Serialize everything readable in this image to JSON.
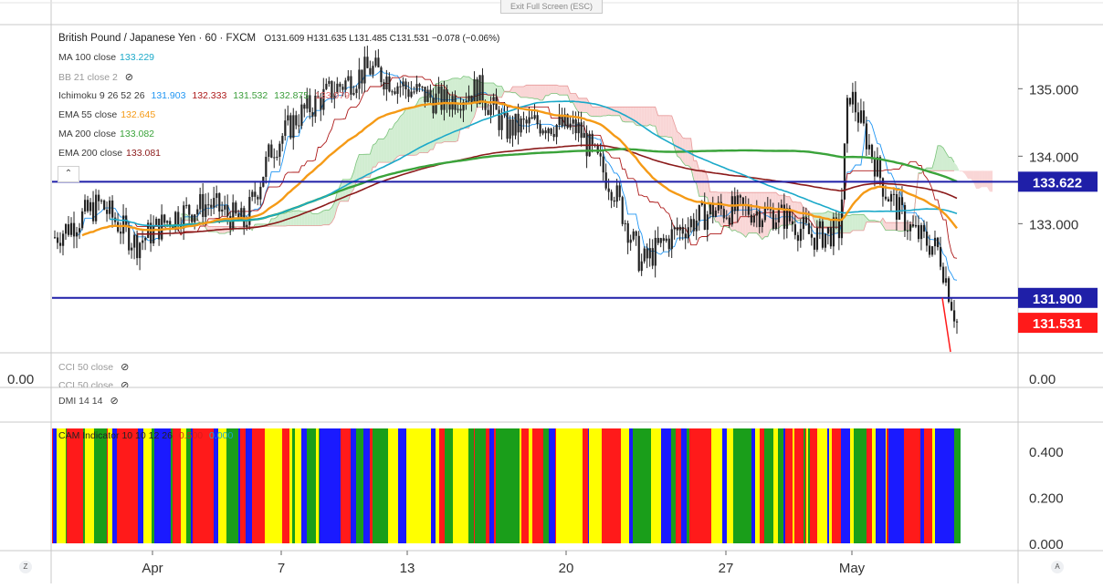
{
  "window": {
    "exit_fullscreen_label": "Exit Full Screen (ESC)"
  },
  "symbol": {
    "name": "British Pound / Japanese Yen",
    "interval": "60",
    "source": "FXCM",
    "ohlc": "O131.609 H131.635 L131.485 C131.531 −0.078 (−0.06%)"
  },
  "indicators": [
    {
      "label": "MA 100 close",
      "value": "133.229",
      "color": "#1ba9c9",
      "hidden": false
    },
    {
      "label": "BB 21 close 2",
      "value": "",
      "color": "#888888",
      "hidden": true
    },
    {
      "label": "Ichimoku 9 26 52 26",
      "values": [
        "131.903",
        "132.333",
        "131.532",
        "132.875",
        "133.979"
      ],
      "colors": [
        "#2196f3",
        "#ad1a1a",
        "#3a9d3a",
        "#3a9d3a",
        "#e06666"
      ],
      "hidden": false
    },
    {
      "label": "EMA 55 close",
      "value": "132.645",
      "color": "#f59a16",
      "hidden": false
    },
    {
      "label": "MA 200 close",
      "value": "133.082",
      "color": "#3aa33a",
      "hidden": false
    },
    {
      "label": "EMA 200 close",
      "value": "133.081",
      "color": "#8b1a1a",
      "hidden": false
    }
  ],
  "panes": {
    "cci1": {
      "label": "CCI 50 close"
    },
    "cci2": {
      "label": "CCI 50 close"
    },
    "dmi": {
      "label": "DMI 14 14"
    },
    "cam": {
      "label": "CAM Indicator 10 10 12 26",
      "values": [
        "0.500",
        "0.000"
      ]
    },
    "zero_left": "0.00",
    "zero_right": "0.00"
  },
  "corners": {
    "left": "Z",
    "right": "A"
  },
  "colors": {
    "candle": "#222222",
    "hline": "#1f1fa8",
    "price_tag": "#ff1a1a",
    "cloud_bull": "#c6e8c6",
    "cloud_bear": "#f7cccc",
    "cam_yellow": "#ffff00",
    "cam_red": "#ff1a1a",
    "cam_blue": "#1a1aff",
    "cam_green": "#1a9e1a"
  },
  "chart_data": {
    "type": "candlestick",
    "title": "British Pound / Japanese Yen · 60 · FXCM",
    "ylim": [
      131.1,
      135.95
    ],
    "y_ticks": [
      133.0,
      134.0,
      135.0
    ],
    "y_tick_labels": [
      "133.000",
      "134.000",
      "135.000"
    ],
    "x_labels": [
      "Apr",
      "7",
      "13",
      "20",
      "27",
      "May"
    ],
    "horizontal_lines": [
      {
        "value": 133.622,
        "label": "133.622"
      },
      {
        "value": 131.9,
        "label": "131.900"
      }
    ],
    "last_price": {
      "value": 131.531,
      "label": "131.531"
    },
    "close_path": [
      [
        "Mar 30",
        132.8
      ],
      [
        "Mar 31",
        133.3
      ],
      [
        "Apr 1",
        132.7
      ],
      [
        "Apr 2",
        133.1
      ],
      [
        "Apr 3",
        133.3
      ],
      [
        "Apr 6",
        133.0
      ],
      [
        "Apr 7",
        134.1
      ],
      [
        "Apr 8",
        134.6
      ],
      [
        "Apr 9",
        135.0
      ],
      [
        "Apr 10",
        135.3
      ],
      [
        "Apr 13",
        135.0
      ],
      [
        "Apr 14",
        134.8
      ],
      [
        "Apr 15",
        135.0
      ],
      [
        "Apr 16",
        134.4
      ],
      [
        "Apr 17",
        134.5
      ],
      [
        "Apr 20",
        134.4
      ],
      [
        "Apr 21",
        133.5
      ],
      [
        "Apr 22",
        132.4
      ],
      [
        "Apr 23",
        132.9
      ],
      [
        "Apr 24",
        133.2
      ],
      [
        "Apr 27",
        133.2
      ],
      [
        "Apr 28",
        133.1
      ],
      [
        "Apr 29",
        132.8
      ],
      [
        "Apr 30",
        132.9
      ],
      [
        "May 1",
        135.0
      ],
      [
        "May 4",
        133.5
      ],
      [
        "May 5",
        132.9
      ],
      [
        "May 6",
        132.6
      ],
      [
        "May 7",
        131.53
      ]
    ],
    "series": [
      {
        "name": "MA 100 close",
        "last": 133.229
      },
      {
        "name": "EMA 55 close",
        "last": 132.645
      },
      {
        "name": "MA 200 close",
        "last": 133.082
      },
      {
        "name": "EMA 200 close",
        "last": 133.081
      }
    ],
    "cam_axis": {
      "ticks": [
        0.0,
        0.2,
        0.4
      ],
      "labels": [
        "0.000",
        "0.200",
        "0.400"
      ]
    }
  }
}
